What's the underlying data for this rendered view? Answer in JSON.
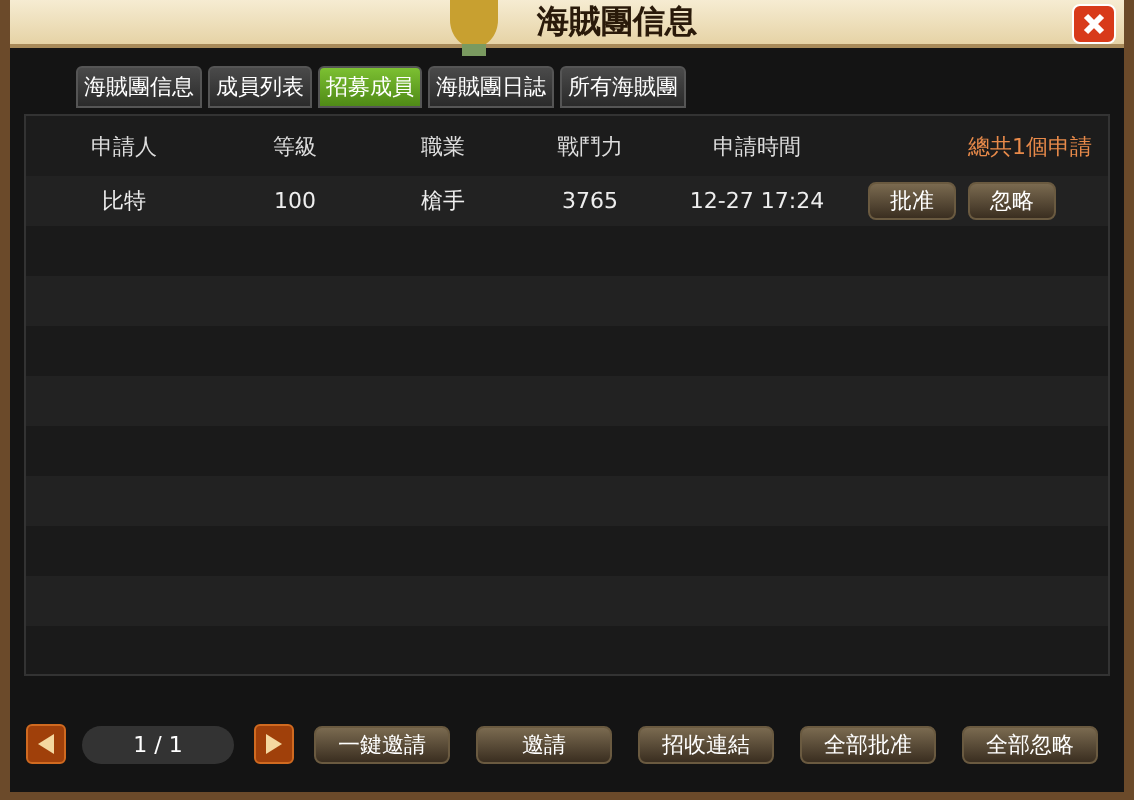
{
  "window": {
    "title": "海賊團信息"
  },
  "tabs": [
    {
      "label": "海賊團信息",
      "selected": false
    },
    {
      "label": "成員列表",
      "selected": false
    },
    {
      "label": "招募成員",
      "selected": true
    },
    {
      "label": "海賊團日誌",
      "selected": false
    },
    {
      "label": "所有海賊團",
      "selected": false
    }
  ],
  "table": {
    "columns": [
      "申請人",
      "等級",
      "職業",
      "戰鬥力",
      "申請時間"
    ],
    "summary": "總共1個申請",
    "rows": [
      {
        "cells": [
          "比特",
          "100",
          "槍手",
          "3765",
          "12-27 17:24"
        ],
        "actions": [
          "批准",
          "忽略"
        ]
      }
    ]
  },
  "pager": {
    "page": "1 / 1"
  },
  "buttons": [
    "一鍵邀請",
    "邀請",
    "招收連結",
    "全部批准",
    "全部忽略"
  ]
}
